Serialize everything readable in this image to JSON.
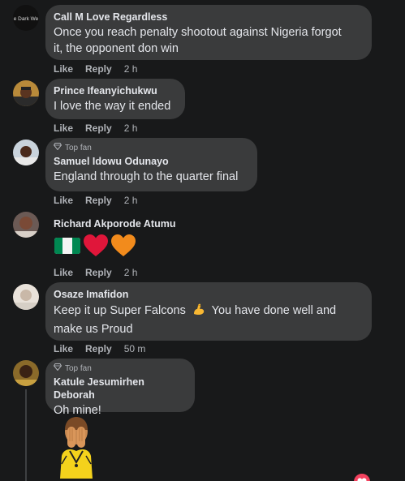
{
  "actions": {
    "like": "Like",
    "reply": "Reply"
  },
  "top_fan_label": "Top fan",
  "comments": [
    {
      "author": "Call M Love Regardless",
      "avatar_text": "e Dark We",
      "text_lines": [
        "Once you reach penalty shootout against Nigeria forgot",
        "it, the opponent don win"
      ],
      "time": "2 h"
    },
    {
      "author": "Prince Ifeanyichukwu",
      "text_lines": [
        "I love the way it ended"
      ],
      "time": "2 h"
    },
    {
      "author": "Samuel Idowu Odunayo",
      "top_fan": true,
      "text_lines": [
        "England through to the quarter final"
      ],
      "time": "2 h"
    },
    {
      "author": "Richard Akporode Atumu",
      "emojis": [
        "nigeria-flag",
        "red-heart",
        "orange-heart"
      ],
      "time": "2 h"
    },
    {
      "author": "Osaze Imafidon",
      "text_lines": [
        "Keep it up Super Falcons",
        "You have done well and",
        "make us Proud"
      ],
      "inline_emoji": "flexed-biceps",
      "time": "50 m"
    },
    {
      "author": "Katule Jesumirhen Deborah",
      "top_fan": true,
      "text_lines": [
        "Oh mine!"
      ],
      "sticker": "facepalm-sticker"
    }
  ],
  "colors": {
    "background": "#18191a",
    "bubble": "#3a3b3c",
    "text": "#e4e6eb",
    "secondary": "#b0b3b8",
    "reaction": "#f3425f"
  }
}
